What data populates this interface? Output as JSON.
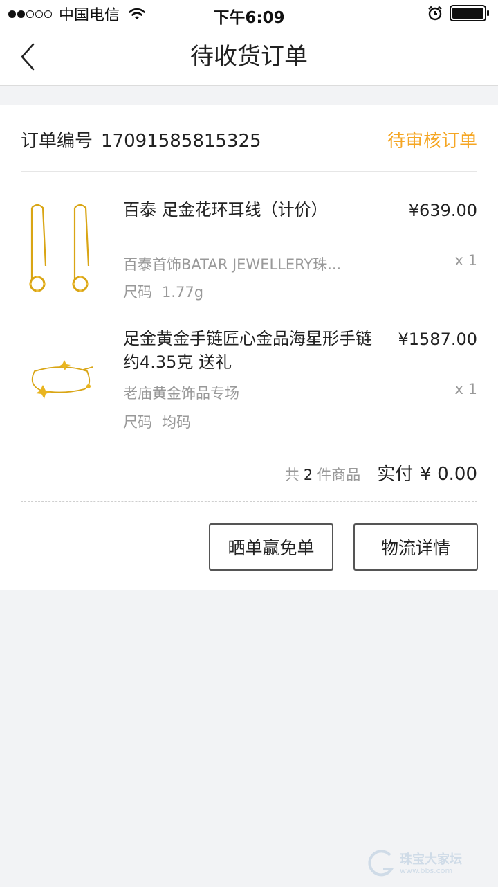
{
  "status_bar": {
    "carrier": "中国电信",
    "time": "下午6:09"
  },
  "nav": {
    "title": "待收货订单"
  },
  "order": {
    "number_label": "订单编号",
    "number": "17091585815325",
    "status": "待审核订单",
    "status_color": "#f5a623",
    "items": [
      {
        "name": "百泰 足金花环耳线（计价）",
        "price": "¥639.00",
        "shop": "百泰首饰BATAR JEWELLERY珠...",
        "qty": "x 1",
        "size_label": "尺码",
        "size": "1.77g"
      },
      {
        "name": "足金黄金手链匠心金品海星形手链约4.35克 送礼",
        "price": "¥1587.00",
        "shop": "老庙黄金饰品专场",
        "qty": "x 1",
        "size_label": "尺码",
        "size": "均码"
      }
    ],
    "summary": {
      "count_prefix": "共",
      "count": "2",
      "count_suffix": "件商品",
      "paid_label": "实付",
      "paid": "¥ 0.00"
    },
    "actions": {
      "share_label": "晒单赢免单",
      "logistics_label": "物流详情"
    }
  },
  "watermark": {
    "text": "珠宝大家坛",
    "sub": "www.bbs.com"
  }
}
